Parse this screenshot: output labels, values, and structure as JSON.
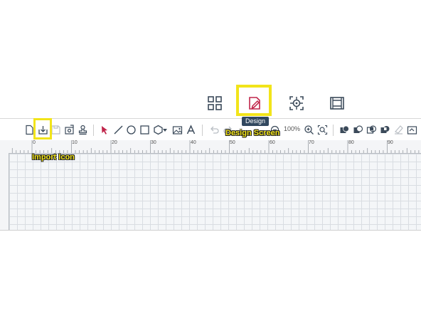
{
  "modebar": {
    "items": [
      {
        "name": "dashboard",
        "icon": "grid-icon"
      },
      {
        "name": "design",
        "icon": "design-edit-icon",
        "active": true,
        "tooltip": "Design"
      },
      {
        "name": "capture",
        "icon": "crosshair-icon"
      },
      {
        "name": "film",
        "icon": "film-icon"
      }
    ]
  },
  "toolbar": {
    "zoom_label": "100%"
  },
  "ruler": {
    "labels": [
      "0",
      "10",
      "20",
      "30",
      "40",
      "50",
      "60",
      "70",
      "80",
      "90"
    ]
  },
  "annotations": {
    "import_label": "Import Icon",
    "design_label": "Design Screen"
  },
  "colors": {
    "highlight": "#f2e41a",
    "accent": "#c0254a",
    "tooltip_bg": "#31475e",
    "icon": "#3b4a5a"
  }
}
